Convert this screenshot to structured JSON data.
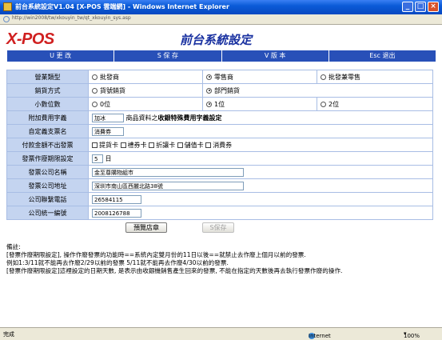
{
  "window": {
    "title": "前台系統設定V1.04 [X-POS 雲端網] - Windows Internet Explorer",
    "address": "http://win2008/tw/xkouyin_tw/qt_xkouyin_sys.asp"
  },
  "header": {
    "logo": "X-POS",
    "title": "前台系統設定"
  },
  "menu": {
    "items": [
      "U 更 改",
      "S 保 存",
      "V 版 本",
      "Esc 退出"
    ]
  },
  "form": {
    "business_type": {
      "label": "營業類型",
      "options": [
        "批發商",
        "零售商",
        "批發兼零售"
      ],
      "selected": 1
    },
    "sales_mode": {
      "label": "銷貨方式",
      "options": [
        "貨號銷貨",
        "部門銷貨"
      ],
      "selected": 1
    },
    "decimals": {
      "label": "小數位數",
      "options": [
        "0位",
        "1位",
        "2位"
      ],
      "selected": 1
    },
    "extra_fee": {
      "label": "附加費用字義",
      "value": "加冰",
      "desc_prefix": "商品資料之",
      "desc_bold": "收銀特殊費用字義設定"
    },
    "custom_payment": {
      "label": "自定義支票名",
      "value": "消費券"
    },
    "no_invoice": {
      "label": "付款金額不出發票",
      "options": [
        "提貨卡",
        "禮券卡",
        "折讓卡",
        "儲值卡",
        "消費券"
      ]
    },
    "invoice_void": {
      "label": "發票作廢期限設定",
      "value": "5",
      "unit": "日"
    },
    "company_name": {
      "label": "發票公司名稱",
      "value": "金至尊購物組市"
    },
    "company_address": {
      "label": "發票公司地址",
      "value": "深圳市南山區西麗北路38號"
    },
    "company_phone": {
      "label": "公司聯繫電話",
      "value": "26584115"
    },
    "company_tax_id": {
      "label": "公司統一編號",
      "value": "2008126788"
    }
  },
  "buttons": {
    "preview": "預覽店章",
    "save": "S保存"
  },
  "notes": [
    "備註:",
    "[發票作廢期限設定], 操作作廢發票的功能時==系統內定雙月份的11日以後==就禁止去作廢上個月以前的發票.",
    "例如1:3/11就不能再去作廢2/29以前的發票  5/11就不能再去作廢4/30以前的發票.",
    "[發票作廢期限設定]這裡設定的日期天數, 是表示由收銀機銷售產生回來的發票, 不能在指定的天數後再去執行發票作廢的操作."
  ],
  "status": {
    "left": "完成",
    "zone": "Internet",
    "zoom": "100%"
  }
}
